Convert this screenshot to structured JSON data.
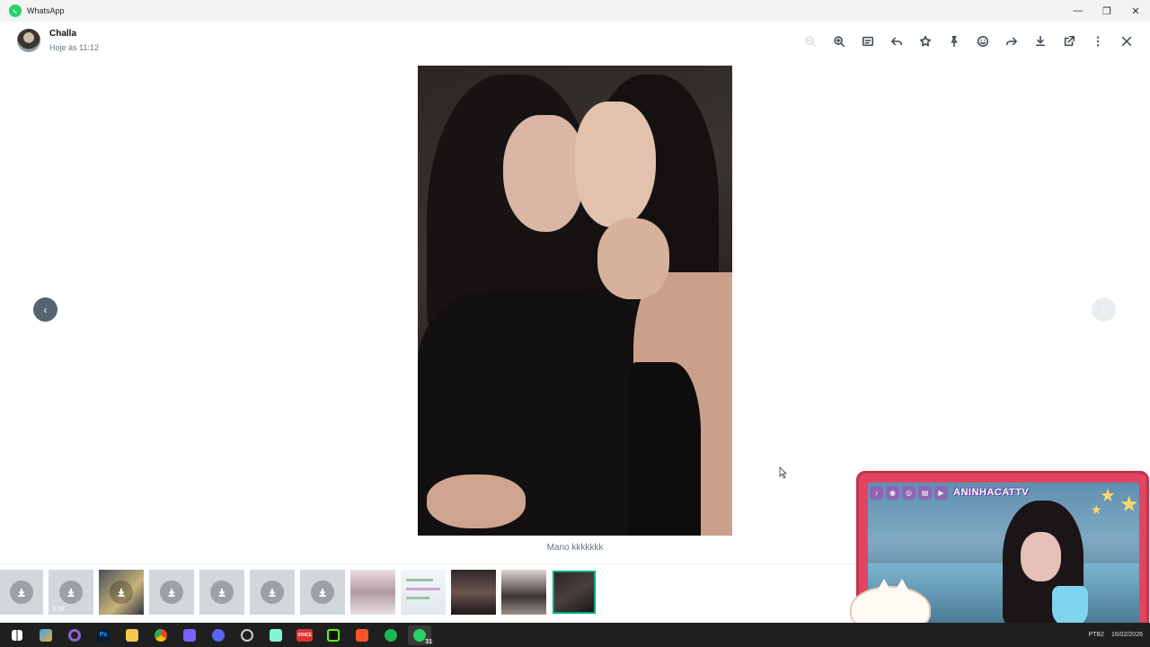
{
  "window": {
    "title": "WhatsApp",
    "controls": {
      "minimize": "—",
      "restore": "❐",
      "close": "✕"
    }
  },
  "viewer": {
    "sender_name": "Challa",
    "timestamp": "Hoje às 11:12",
    "toolbar": [
      {
        "name": "zoom-out-icon",
        "enabled": false
      },
      {
        "name": "zoom-in-icon",
        "enabled": true
      },
      {
        "name": "caption-icon",
        "enabled": true
      },
      {
        "name": "reply-icon",
        "enabled": true
      },
      {
        "name": "star-icon",
        "enabled": true
      },
      {
        "name": "pin-icon",
        "enabled": true
      },
      {
        "name": "emoji-react-icon",
        "enabled": true
      },
      {
        "name": "forward-icon",
        "enabled": true
      },
      {
        "name": "download-icon",
        "enabled": true
      },
      {
        "name": "open-external-icon",
        "enabled": true
      },
      {
        "name": "more-options-icon",
        "enabled": true
      },
      {
        "name": "close-icon",
        "enabled": true
      }
    ],
    "caption": "Mano kkkkkkk",
    "nav": {
      "prev": "‹",
      "next": "›"
    }
  },
  "thumbnails": [
    {
      "kind": "download",
      "duration": ""
    },
    {
      "kind": "download",
      "duration": "3:38",
      "video": true
    },
    {
      "kind": "image-download",
      "duration": ""
    },
    {
      "kind": "download",
      "duration": ""
    },
    {
      "kind": "download",
      "duration": ""
    },
    {
      "kind": "download",
      "duration": ""
    },
    {
      "kind": "download",
      "duration": ""
    },
    {
      "kind": "image",
      "duration": ""
    },
    {
      "kind": "image",
      "duration": ""
    },
    {
      "kind": "image",
      "duration": ""
    },
    {
      "kind": "image",
      "duration": ""
    },
    {
      "kind": "image-selected",
      "duration": ""
    }
  ],
  "stream_overlay": {
    "handle": "ANINHACATTV",
    "socials": [
      "tiktok-icon",
      "discord-icon",
      "instagram-icon",
      "twitch-icon",
      "youtube-icon"
    ]
  },
  "taskbar": {
    "apps": [
      {
        "name": "start-icon",
        "color": "#ffffff"
      },
      {
        "name": "copilot-icon",
        "color": "#3aa0f0"
      },
      {
        "name": "cortana-icon",
        "color": "#8a63d2"
      },
      {
        "name": "photoshop-icon",
        "color": "#31a8ff",
        "label": "Ps"
      },
      {
        "name": "file-explorer-icon",
        "color": "#f2c94c"
      },
      {
        "name": "chrome-icon",
        "color": "#34a853"
      },
      {
        "name": "video-editor-icon",
        "color": "#7b61ff"
      },
      {
        "name": "discord-icon",
        "color": "#5865f2"
      },
      {
        "name": "obs-icon",
        "color": "#cccccc"
      },
      {
        "name": "streamlabs-icon",
        "color": "#80f5d2"
      },
      {
        "name": "voicemeeter-icon",
        "color": "#d33",
        "label": "VOICE"
      },
      {
        "name": "kick-icon",
        "color": "#53fc18"
      },
      {
        "name": "brave-icon",
        "color": "#fb542b"
      },
      {
        "name": "spotify-icon",
        "color": "#1db954"
      },
      {
        "name": "whatsapp-icon",
        "color": "#25d366",
        "badge": "31",
        "active": true
      }
    ],
    "tray": {
      "lang": "PTB2",
      "date": "16/02/2026"
    }
  }
}
